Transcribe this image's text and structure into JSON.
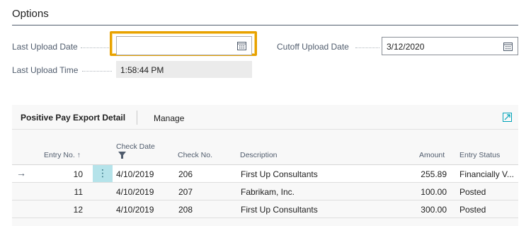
{
  "options": {
    "title": "Options",
    "last_upload_date_label": "Last Upload Date",
    "last_upload_date_value": "",
    "last_upload_time_label": "Last Upload Time",
    "last_upload_time_value": "1:58:44 PM",
    "cutoff_upload_date_label": "Cutoff Upload Date",
    "cutoff_upload_date_value": "3/12/2020"
  },
  "part": {
    "title": "Positive Pay Export Detail",
    "manage_label": "Manage",
    "columns": {
      "entry_no": "Entry No. ↑",
      "check_date": "Check Date",
      "check_no": "Check No.",
      "description": "Description",
      "amount": "Amount",
      "entry_status": "Entry Status"
    },
    "rows": [
      {
        "entry_no": "10",
        "check_date": "4/10/2019",
        "check_no": "206",
        "description": "First Up Consultants",
        "amount": "255.89",
        "entry_status": "Financially V..."
      },
      {
        "entry_no": "11",
        "check_date": "4/10/2019",
        "check_no": "207",
        "description": "Fabrikam, Inc.",
        "amount": "100.00",
        "entry_status": "Posted"
      },
      {
        "entry_no": "12",
        "check_date": "4/10/2019",
        "check_no": "208",
        "description": "First Up Consultants",
        "amount": "300.00",
        "entry_status": "Posted"
      }
    ]
  },
  "icons": {
    "calendar": "calendar-icon",
    "filter": "filter-icon",
    "expand": "expand-icon",
    "row_arrow": "→",
    "row_menu": "⋮"
  },
  "colors": {
    "focus_ring": "#e8a200",
    "row_menu_bg": "#b5e3ea",
    "accent": "#00a3b8"
  }
}
